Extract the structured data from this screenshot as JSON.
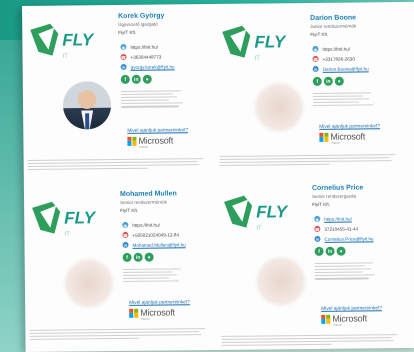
{
  "brand": {
    "logo_text": "FLY",
    "accent": "#2bb59f",
    "link_color": "#1a6fb0",
    "name_color": "#1b7fb5"
  },
  "partners_label": "Mivel ajánljuk partnereinket?",
  "microsoft": {
    "word": "Microsoft",
    "sub": "Partner"
  },
  "social_icons": [
    "facebook-icon",
    "linkedin-icon",
    "website-icon"
  ],
  "cards": [
    {
      "name": "Korek György",
      "role": "Ügyvezető igazgató",
      "company": "FlyIT Kft.",
      "website": "https://fnit.hu/",
      "phone": "+36304448773",
      "email": "gyorgy.korek@flyit.hu",
      "photo": "clear"
    },
    {
      "name": "Darion Boone",
      "role": "Junior rendszermérnök",
      "company": "FlyIT Kft.",
      "website": "https://fnit.hu/",
      "phone": "+3317836-2630",
      "email": "Darion.Boone@flyit.hu",
      "photo": "blur"
    },
    {
      "name": "Mohamed Mullen",
      "role": "Senior rendszermérnök",
      "company": "FlyIT Kft.",
      "website": "https://fnit.hu/",
      "phone": "+505021024049-12-84",
      "email": "Mohamed.Mullen@flyit.hu",
      "photo": "blur"
    },
    {
      "name": "Cornelius Price",
      "role": "Senior rendszergazda",
      "company": "FlyIT Kft.",
      "website": "https://fnit.hu/",
      "phone": "37210455-41-44",
      "email": "Cornelius.Price@flyit.hu",
      "photo": "blur"
    }
  ]
}
